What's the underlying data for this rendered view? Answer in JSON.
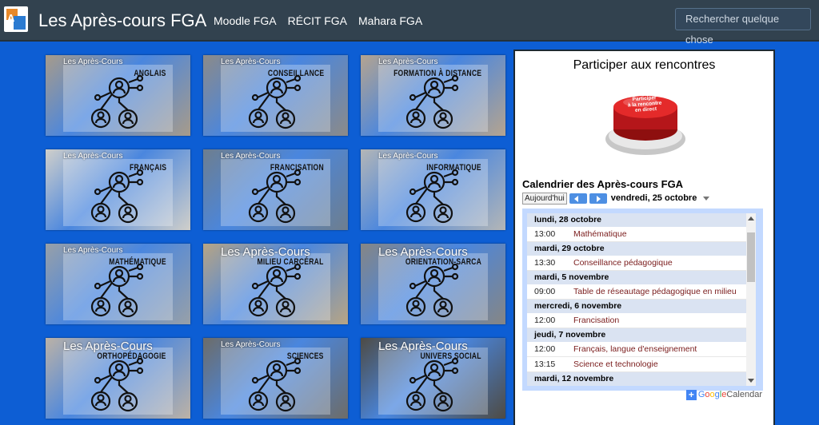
{
  "header": {
    "logo_text": "A",
    "title": "Les Après-cours FGA",
    "nav": [
      "Moodle FGA",
      "RÉCIT FGA",
      "Mahara FGA"
    ],
    "search_placeholder": "Rechercher quelque chose"
  },
  "tiles": [
    {
      "brand": "Les Après-Cours",
      "label": "ANGLAIS",
      "bg": "#a79b8a",
      "big": false
    },
    {
      "brand": "Les Après-Cours",
      "label": "CONSEILLANCE",
      "bg": "#8c8a88",
      "big": false
    },
    {
      "brand": "Les Après-Cours",
      "label": "FORMATION À DISTANCE",
      "bg": "#b5a48f",
      "big": false
    },
    {
      "brand": "Les Après-Cours",
      "label": "FRANÇAIS",
      "bg": "#d0cfca",
      "big": false
    },
    {
      "brand": "Les Après-Cours",
      "label": "FRANCISATION",
      "bg": "#6e7e8e",
      "big": false
    },
    {
      "brand": "Les Après-Cours",
      "label": "INFORMATIQUE",
      "bg": "#b4b6b6",
      "big": false
    },
    {
      "brand": "Les Après-Cours",
      "label": "MATHÉMATIQUE",
      "bg": "#98a0a8",
      "big": false
    },
    {
      "brand": "Les Après-Cours",
      "label": "MILIEU CARCÉRAL",
      "bg": "#b8a584",
      "big": true
    },
    {
      "brand": "Les Après-Cours",
      "label": "ORIENTATION-SARCA",
      "bg": "#868684",
      "big": true
    },
    {
      "brand": "Les Après-Cours",
      "label": "ORTHOPÉDAGOGIE",
      "bg": "#bcb2a6",
      "big": true
    },
    {
      "brand": "Les Après-Cours",
      "label": "SCIENCES",
      "bg": "#6d6c68",
      "big": false
    },
    {
      "brand": "Les Après-Cours",
      "label": "UNIVERS SOCIAL",
      "bg": "#4e4b44",
      "big": true
    }
  ],
  "sidebar": {
    "title": "Participer aux rencontres",
    "button_text": "Participer à la rencontre en direct"
  },
  "calendar": {
    "title": "Calendrier des Après-cours FGA",
    "today_label": "Aujourd'hui",
    "current_date": "vendredi, 25 octobre",
    "brand": "Calendar",
    "agenda": [
      {
        "day": "lundi, 28 octobre",
        "events": [
          {
            "time": "13:00",
            "name": "Mathématique"
          }
        ]
      },
      {
        "day": "mardi, 29 octobre",
        "events": [
          {
            "time": "13:30",
            "name": "Conseillance pédagogique"
          }
        ]
      },
      {
        "day": "mardi, 5 novembre",
        "events": [
          {
            "time": "09:00",
            "name": "Table de réseautage pédagogique en milieu"
          }
        ]
      },
      {
        "day": "mercredi, 6 novembre",
        "events": [
          {
            "time": "12:00",
            "name": "Francisation"
          }
        ]
      },
      {
        "day": "jeudi, 7 novembre",
        "events": [
          {
            "time": "12:00",
            "name": "Français, langue d'enseignement"
          },
          {
            "time": "13:15",
            "name": "Science et technologie"
          }
        ]
      },
      {
        "day": "mardi, 12 novembre",
        "events": []
      }
    ]
  },
  "colors": {
    "page_bg": "#0d5ed4",
    "header_bg": "#32424f",
    "event_text": "#7a1c1c",
    "day_bg": "#dae3f2"
  }
}
